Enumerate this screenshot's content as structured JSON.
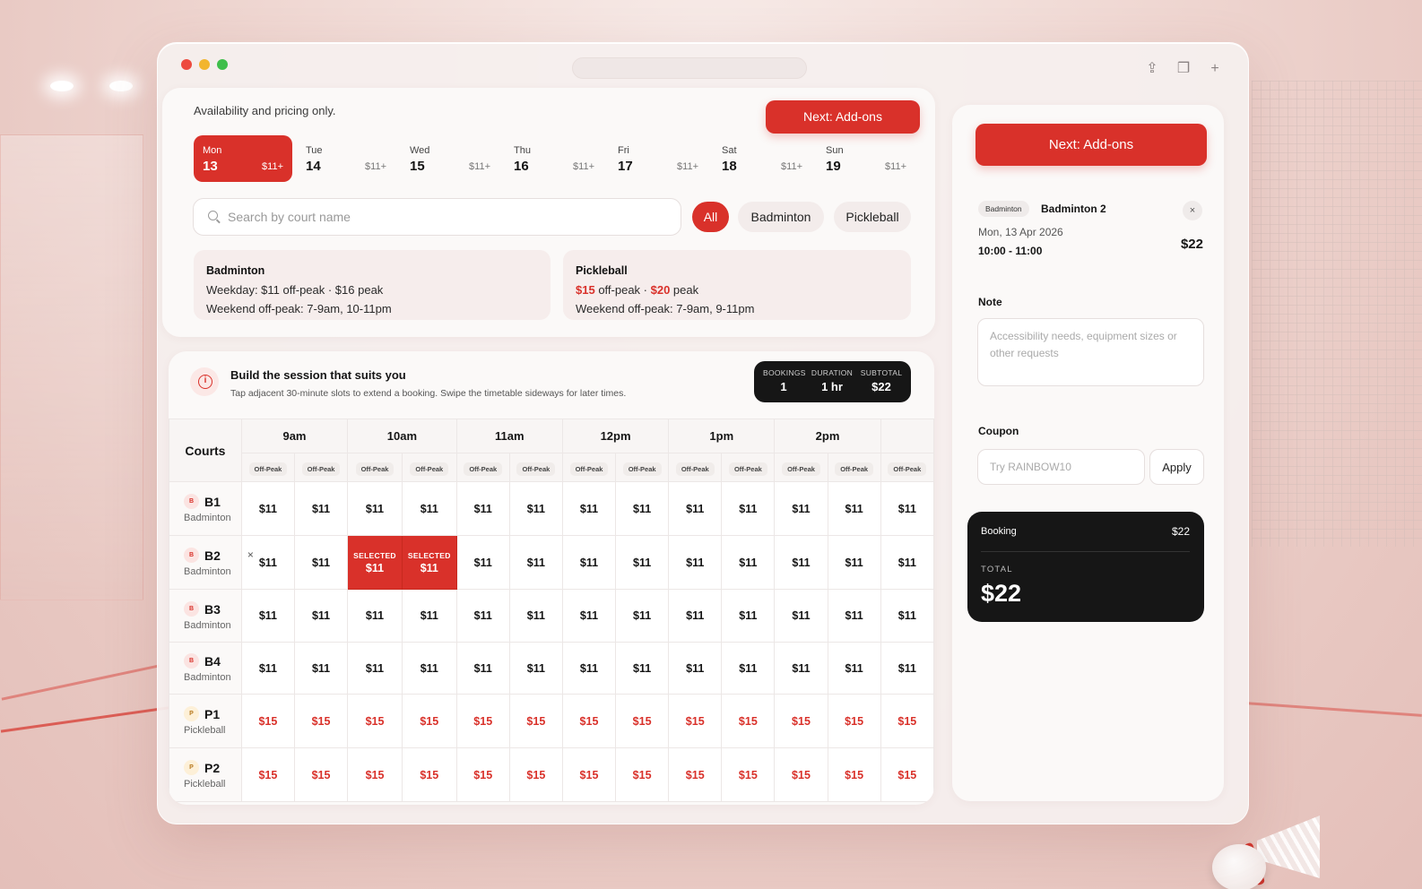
{
  "colors": {
    "accent": "#d9312a",
    "dark": "#161616",
    "pickleball_badge": "#b7791f"
  },
  "header": {
    "note": "Availability and pricing only.",
    "next_label": "Next: Add-ons"
  },
  "days": [
    {
      "name": "Mon",
      "date": "13",
      "price": "$11+",
      "active": true
    },
    {
      "name": "Tue",
      "date": "14",
      "price": "$11+",
      "active": false
    },
    {
      "name": "Wed",
      "date": "15",
      "price": "$11+",
      "active": false
    },
    {
      "name": "Thu",
      "date": "16",
      "price": "$11+",
      "active": false
    },
    {
      "name": "Fri",
      "date": "17",
      "price": "$11+",
      "active": false
    },
    {
      "name": "Sat",
      "date": "18",
      "price": "$11+",
      "active": false
    },
    {
      "name": "Sun",
      "date": "19",
      "price": "$11+",
      "active": false
    }
  ],
  "search": {
    "placeholder": "Search by court name",
    "value": ""
  },
  "filters": {
    "all": "All",
    "badminton": "Badminton",
    "pickleball": "Pickleball",
    "selected": "All"
  },
  "pricing": {
    "badminton": {
      "title": "Badminton",
      "line1": "Weekday: $11 off-peak · $16 peak",
      "line2": "Weekend off-peak: 7-9am, 10-11pm"
    },
    "pickleball": {
      "title": "Pickleball",
      "offpeak_price": "$15",
      "offpeak_text": " off-peak · ",
      "peak_price": "$20",
      "peak_text": " peak",
      "line2": "Weekend off-peak: 7-9am, 9-11pm"
    }
  },
  "build": {
    "title": "Build the session that suits you",
    "subtitle": "Tap adjacent 30-minute slots to extend a booking. Swipe the timetable sideways for later times."
  },
  "stats": {
    "bookings_label": "BOOKINGS",
    "bookings": "1",
    "duration_label": "DURATION",
    "duration": "1 hr",
    "subtotal_label": "SUBTOTAL",
    "subtotal": "$22"
  },
  "timetable": {
    "courts_header": "Courts",
    "hours": [
      "9am",
      "10am",
      "11am",
      "12pm",
      "1pm",
      "2pm"
    ],
    "peak_label": "Off-Peak",
    "selected_label": "SELECTED",
    "remove_symbol": "×",
    "courts": [
      {
        "code": "B1",
        "badge": "B",
        "sport": "Badminton",
        "price": "$11",
        "selected": []
      },
      {
        "code": "B2",
        "badge": "B",
        "sport": "Badminton",
        "price": "$11",
        "selected": [
          2,
          3
        ],
        "removable": true
      },
      {
        "code": "B3",
        "badge": "B",
        "sport": "Badminton",
        "price": "$11",
        "selected": []
      },
      {
        "code": "B4",
        "badge": "B",
        "sport": "Badminton",
        "price": "$11",
        "selected": []
      },
      {
        "code": "P1",
        "badge": "P",
        "sport": "Pickleball",
        "price": "$15",
        "selected": []
      },
      {
        "code": "P2",
        "badge": "P",
        "sport": "Pickleball",
        "price": "$15",
        "selected": []
      }
    ]
  },
  "sidebar": {
    "next_label": "Next: Add-ons",
    "booking": {
      "sport": "Badminton",
      "court": "Badminton 2",
      "date": "Mon, 13 Apr 2026",
      "time": "10:00 - 11:00",
      "price": "$22",
      "close": "×"
    },
    "note_label": "Note",
    "note_placeholder": "Accessibility needs, equipment sizes or other requests",
    "coupon_label": "Coupon",
    "coupon_placeholder": "Try RAINBOW10",
    "apply_label": "Apply",
    "summary": {
      "booking_label": "Booking",
      "booking_price": "$22",
      "total_label": "TOTAL",
      "total": "$22"
    }
  }
}
